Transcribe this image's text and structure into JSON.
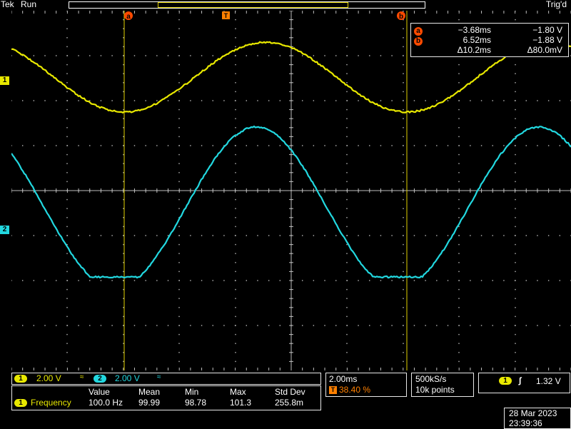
{
  "header": {
    "brand": "Tek",
    "run_state": "Run",
    "trigger_state": "Trig'd"
  },
  "colors": {
    "ch1": "#e8e800",
    "ch2": "#22d8e0",
    "cursor_badge": "#ff4a00",
    "trigger_badge": "#ff8000",
    "grid": "#bdbdbd"
  },
  "cursors": {
    "a": {
      "label": "a",
      "time": "−3.68ms",
      "volt": "−1.80 V"
    },
    "b": {
      "label": "b",
      "time": "6.52ms",
      "volt": "−1.88 V"
    },
    "delta": {
      "time": "Δ10.2ms",
      "volt": "Δ80.0mV"
    }
  },
  "markers": {
    "ch1": "1",
    "ch2": "2",
    "trigger": "T"
  },
  "channels": {
    "ch1": {
      "num": "1",
      "scale": "2.00 V",
      "bw_icon": "bw-limit-icon"
    },
    "ch2": {
      "num": "2",
      "scale": "2.00 V",
      "bw_icon": "bw-limit-icon"
    }
  },
  "measurement": {
    "headers": [
      "Value",
      "Mean",
      "Min",
      "Max",
      "Std Dev"
    ],
    "channel": "1",
    "name": "Frequency",
    "values": [
      "100.0 Hz",
      "99.99",
      "98.78",
      "101.3",
      "255.8m"
    ]
  },
  "timebase": {
    "scale": "2.00ms",
    "trigger_pos_label": "T",
    "trigger_pos": "38.40 %"
  },
  "acquisition": {
    "rate": "500kS/s",
    "points": "10k points"
  },
  "trigger": {
    "channel": "1",
    "slope_icon": "rising-edge-icon",
    "level": "1.32 V"
  },
  "datetime": {
    "date": "28 Mar  2023",
    "time": "23:39:36"
  }
}
